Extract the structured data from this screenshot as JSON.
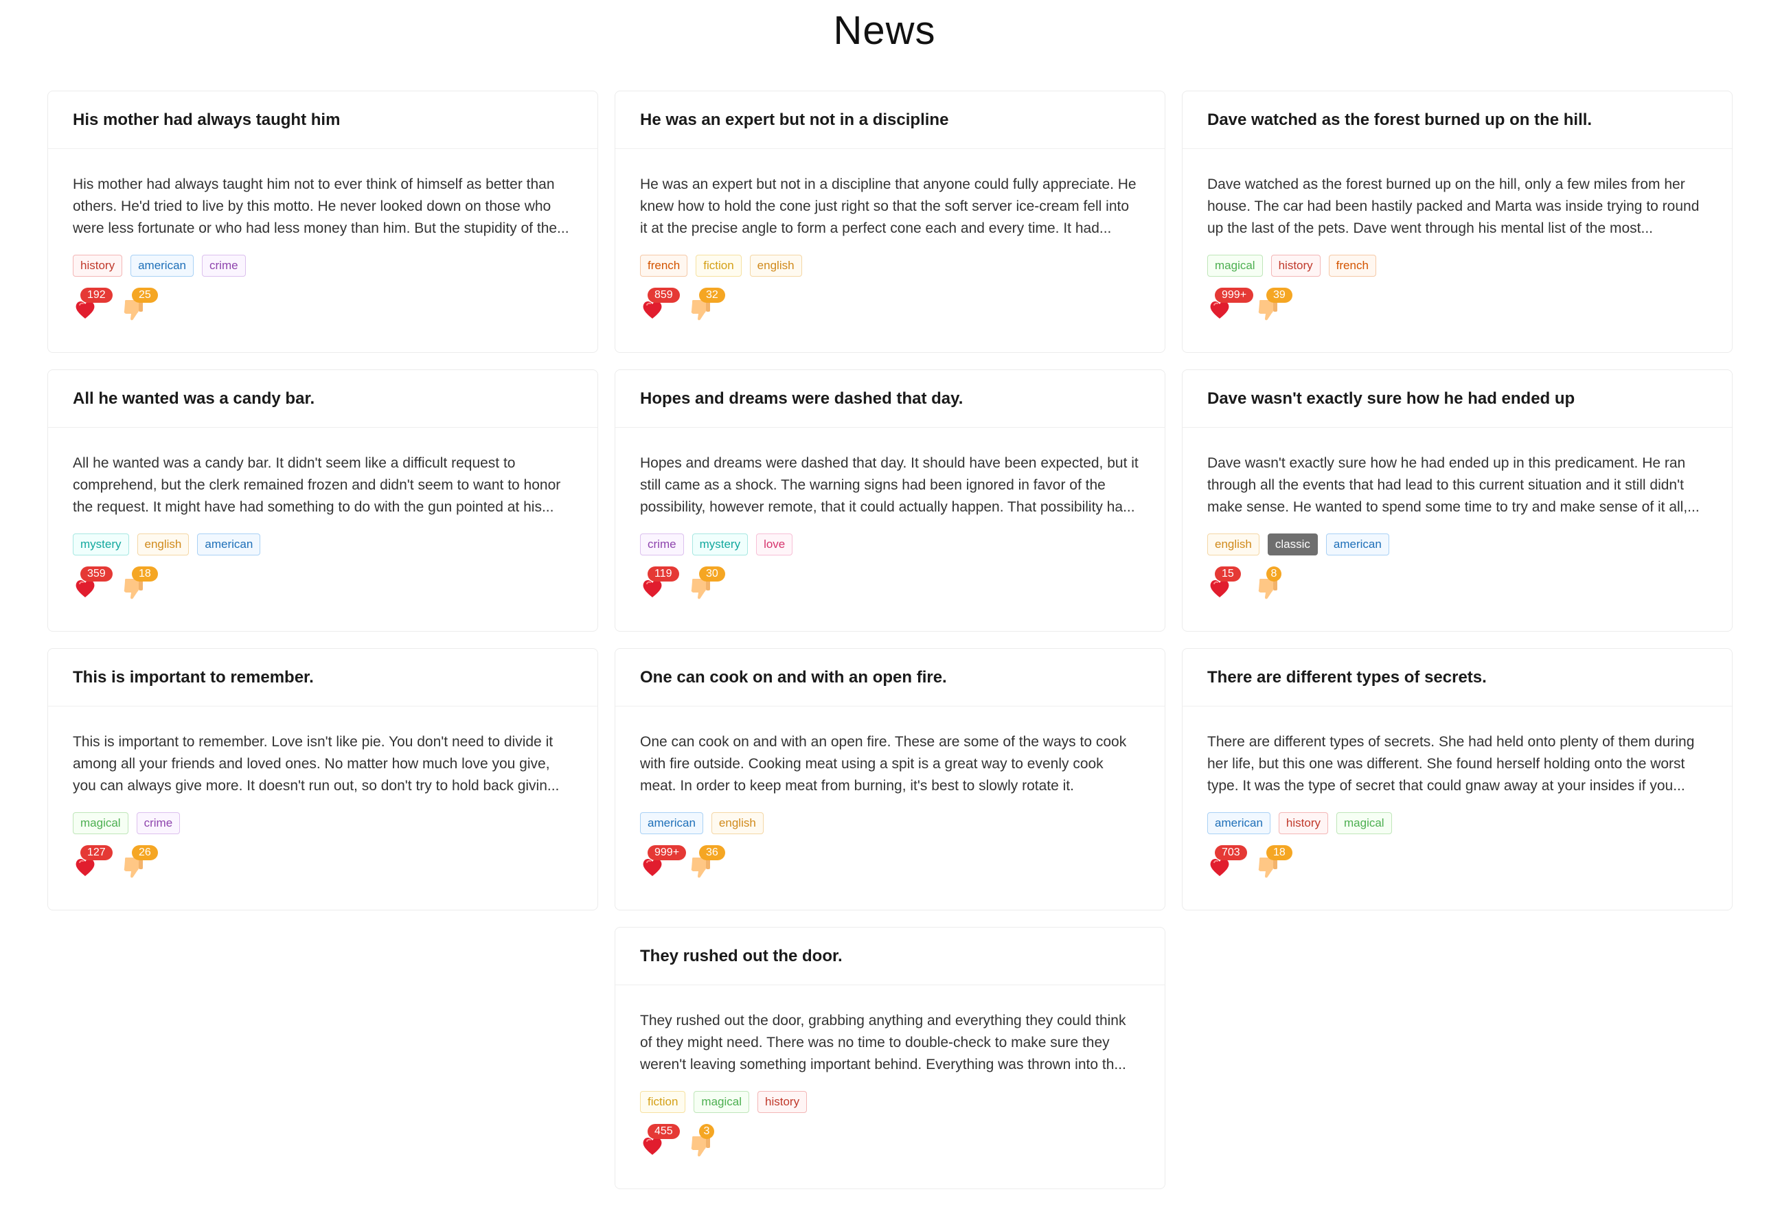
{
  "page": {
    "title": "News"
  },
  "tag_colors": {
    "history": {
      "text": "#c0392b",
      "border": "#f3b6b6",
      "bg": "#fff5f5"
    },
    "american": {
      "text": "#1e6fb8",
      "border": "#a9d1f5",
      "bg": "#f1f8ff"
    },
    "crime": {
      "text": "#8e44ad",
      "border": "#dcc0ee",
      "bg": "#fbf5ff"
    },
    "french": {
      "text": "#d35400",
      "border": "#f5c9a7",
      "bg": "#fff7f0"
    },
    "fiction": {
      "text": "#d4a017",
      "border": "#f6e1a0",
      "bg": "#fffcef"
    },
    "english": {
      "text": "#d08a1c",
      "border": "#f4d7a5",
      "bg": "#fffaf0"
    },
    "magical": {
      "text": "#4caf50",
      "border": "#bfe6b9",
      "bg": "#f6fff4"
    },
    "mystery": {
      "text": "#13a89e",
      "border": "#a7e8e2",
      "bg": "#f0fffd"
    },
    "love": {
      "text": "#d6336c",
      "border": "#f7bfd6",
      "bg": "#fff5f9"
    },
    "classic": {
      "text": "#ffffff",
      "border": "#6f6f6f",
      "bg": "#6f6f6f"
    }
  },
  "colors": {
    "like_badge": "#e53935",
    "dislike_badge": "#f5a623",
    "heart": "#e11d2e",
    "thumb": "#ffc785"
  },
  "articles": [
    {
      "title": "His mother had always taught him",
      "body": "His mother had always taught him not to ever think of himself as better than others. He'd tried to live by this motto. He never looked down on those who were less fortunate or who had less money than him. But the stupidity of the...",
      "tags": [
        "history",
        "american",
        "crime"
      ],
      "likes": "192",
      "dislikes": "25"
    },
    {
      "title": "He was an expert but not in a discipline",
      "body": "He was an expert but not in a discipline that anyone could fully appreciate. He knew how to hold the cone just right so that the soft server ice-cream fell into it at the precise angle to form a perfect cone each and every time. It had...",
      "tags": [
        "french",
        "fiction",
        "english"
      ],
      "likes": "859",
      "dislikes": "32"
    },
    {
      "title": "Dave watched as the forest burned up on the hill.",
      "body": "Dave watched as the forest burned up on the hill, only a few miles from her house. The car had been hastily packed and Marta was inside trying to round up the last of the pets. Dave went through his mental list of the most...",
      "tags": [
        "magical",
        "history",
        "french"
      ],
      "likes": "999+",
      "dislikes": "39"
    },
    {
      "title": "All he wanted was a candy bar.",
      "body": "All he wanted was a candy bar. It didn't seem like a difficult request to comprehend, but the clerk remained frozen and didn't seem to want to honor the request. It might have had something to do with the gun pointed at his...",
      "tags": [
        "mystery",
        "english",
        "american"
      ],
      "likes": "359",
      "dislikes": "18"
    },
    {
      "title": "Hopes and dreams were dashed that day.",
      "body": "Hopes and dreams were dashed that day. It should have been expected, but it still came as a shock. The warning signs had been ignored in favor of the possibility, however remote, that it could actually happen. That possibility ha...",
      "tags": [
        "crime",
        "mystery",
        "love"
      ],
      "likes": "119",
      "dislikes": "30"
    },
    {
      "title": "Dave wasn't exactly sure how he had ended up",
      "body": "Dave wasn't exactly sure how he had ended up in this predicament. He ran through all the events that had lead to this current situation and it still didn't make sense. He wanted to spend some time to try and make sense of it all,...",
      "tags": [
        "english",
        "classic",
        "american"
      ],
      "likes": "15",
      "dislikes": "8"
    },
    {
      "title": "This is important to remember.",
      "body": "This is important to remember. Love isn't like pie. You don't need to divide it among all your friends and loved ones. No matter how much love you give, you can always give more. It doesn't run out, so don't try to hold back givin...",
      "tags": [
        "magical",
        "crime"
      ],
      "likes": "127",
      "dislikes": "26"
    },
    {
      "title": "One can cook on and with an open fire.",
      "body": "One can cook on and with an open fire. These are some of the ways to cook with fire outside. Cooking meat using a spit is a great way to evenly cook meat. In order to keep meat from burning, it's best to slowly rotate it.",
      "tags": [
        "american",
        "english"
      ],
      "likes": "999+",
      "dislikes": "36"
    },
    {
      "title": "There are different types of secrets.",
      "body": "There are different types of secrets. She had held onto plenty of them during her life, but this one was different. She found herself holding onto the worst type. It was the type of secret that could gnaw away at your insides if you...",
      "tags": [
        "american",
        "history",
        "magical"
      ],
      "likes": "703",
      "dislikes": "18"
    },
    {
      "title": "They rushed out the door.",
      "body": "They rushed out the door, grabbing anything and everything they could think of they might need. There was no time to double-check to make sure they weren't leaving something important behind. Everything was thrown into th...",
      "tags": [
        "fiction",
        "magical",
        "history"
      ],
      "likes": "455",
      "dislikes": "3"
    }
  ]
}
